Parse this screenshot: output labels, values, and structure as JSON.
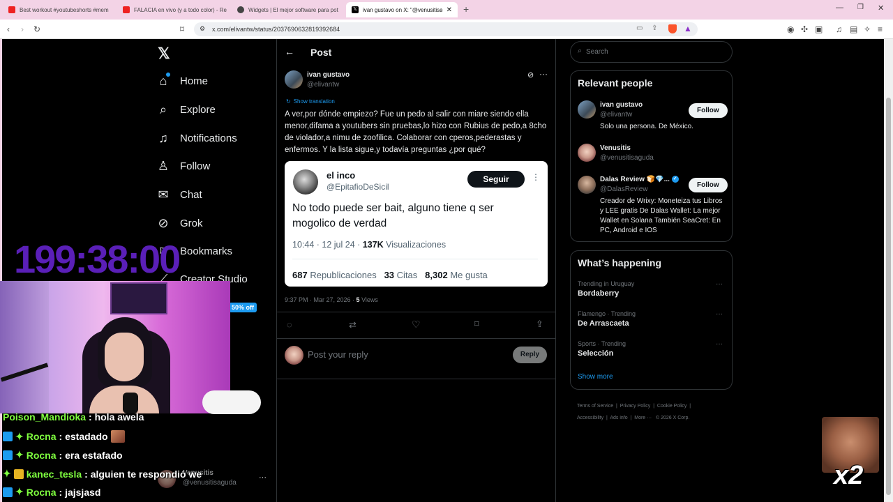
{
  "browser": {
    "tabs": [
      {
        "label": "Best workout #youtubeshorts #mem",
        "active": false
      },
      {
        "label": "FALACIA en vivo (y a todo color) - Re",
        "active": false
      },
      {
        "label": "Widgets | El mejor software para pot",
        "active": false
      },
      {
        "label": "ivan gustavo on X: \"@venusitisa",
        "active": true
      }
    ],
    "url": "x.com/elivantw/status/2037690632819392684"
  },
  "nav": {
    "items": [
      "Home",
      "Explore",
      "Notifications",
      "Follow",
      "Chat",
      "Grok",
      "Bookmarks",
      "Creator Studio"
    ],
    "premium_badge": "50% off"
  },
  "post": {
    "header": "Post",
    "author_name": "ivan gustavo",
    "author_handle": "@elivantw",
    "show_translation": "Show translation",
    "text": "A ver,por dónde empiezo? Fue un pedo al salir con miare siendo ella menor,difama a youtubers sin pruebas,lo hizo con Rubius de pedo,a 8cho de violador,a nimu de zoofilica. Colaborar con cperos,pederastas y enfermos. Y la lista sigue,y todavía preguntas ¿por qué?",
    "quote": {
      "name": "el inco",
      "handle": "@EpitafioDeSicil",
      "follow_label": "Seguir",
      "text": "No todo puede ser bait, alguno tiene q ser mogolico de verdad",
      "time": "10:44 · 12 jul 24 · ",
      "views_count": "137K",
      "views_label": "Visualizaciones",
      "reposts_count": "687",
      "reposts_label": "Republicaciones",
      "quotes_count": "33",
      "quotes_label": "Citas",
      "likes_count": "8,302",
      "likes_label": "Me gusta"
    },
    "meta_time": "9:37 PM · Mar 27, 2026 · ",
    "meta_views_count": "5",
    "meta_views_label": " Views",
    "reply_placeholder": "Post your reply",
    "reply_button": "Reply"
  },
  "sidebar": {
    "search_placeholder": "Search",
    "relevant_title": "Relevant people",
    "people": [
      {
        "name": "ivan gustavo",
        "handle": "@elivantw",
        "bio": "Solo una persona. De México.",
        "follow": "Follow"
      },
      {
        "name": "Venusitis",
        "handle": "@venusitisaguda",
        "bio": "",
        "follow": ""
      },
      {
        "name": "Dalas Review 🍞💎... ",
        "handle": "@DalasReview",
        "bio": "Creador de Wrixy: Moneteiza tus Libros y LEE gratis De Dalas Wallet: La mejor Wallet en Solana También SeaCret: En PC, Android e IOS",
        "follow": "Follow"
      }
    ],
    "happening_title": "What’s happening",
    "trends": [
      {
        "context": "Trending in Uruguay",
        "title": "Bordaberry"
      },
      {
        "context": "Flamengo · Trending",
        "title": "De Arrascaeta"
      },
      {
        "context": "Sports · Trending",
        "title": "Selección"
      }
    ],
    "show_more": "Show more",
    "footer": [
      "Terms of Service",
      "Privacy Policy",
      "Cookie Policy",
      "Accessibility",
      "Ads info",
      "More ···",
      "© 2026 X Corp."
    ]
  },
  "overlay": {
    "timer": "199:38:00",
    "account_switcher_name": "Venusitis",
    "account_switcher_handle": "@venusitisaguda",
    "multiplier": "x2",
    "chat": [
      {
        "user": "Poison_Mandioka",
        "message": ": hola awela"
      },
      {
        "user": "Rocna",
        "message": ": estadado"
      },
      {
        "user": "Rocna",
        "message": ": era estafado"
      },
      {
        "user": "kanec_tesla",
        "message": ": alguien te respondió we"
      },
      {
        "user": "Rocna",
        "message": ": jajsjasd"
      }
    ]
  },
  "colors": {
    "timer": "#5a1fb8",
    "accent": "#1d9bf0",
    "chat_name": "#7fff3f"
  }
}
